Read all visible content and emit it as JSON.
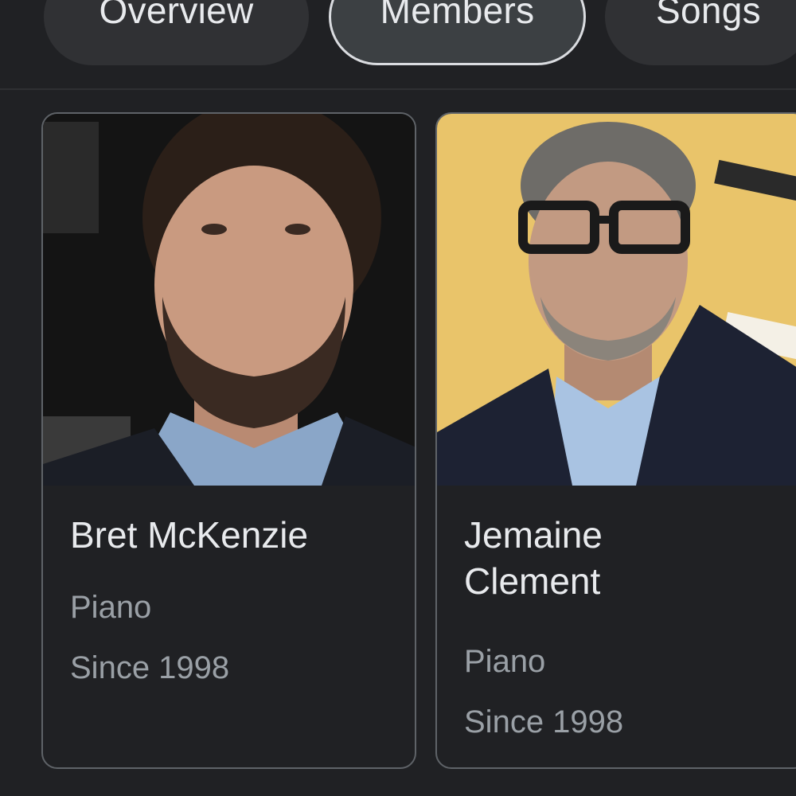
{
  "tabs": [
    {
      "label": "Overview",
      "selected": false
    },
    {
      "label": "Members",
      "selected": true
    },
    {
      "label": "Songs",
      "selected": false
    }
  ],
  "members": [
    {
      "name": "Bret McKenzie",
      "role": "Piano",
      "since": "Since 1998"
    },
    {
      "name": "Jemaine Clement",
      "role": "Piano",
      "since": "Since 1998"
    }
  ],
  "colors": {
    "background": "#202124",
    "tab_background": "#303134",
    "tab_selected_border": "#dadce0",
    "card_border": "#5f6368",
    "primary_text": "#e8eaed",
    "secondary_text": "#9aa0a6"
  }
}
